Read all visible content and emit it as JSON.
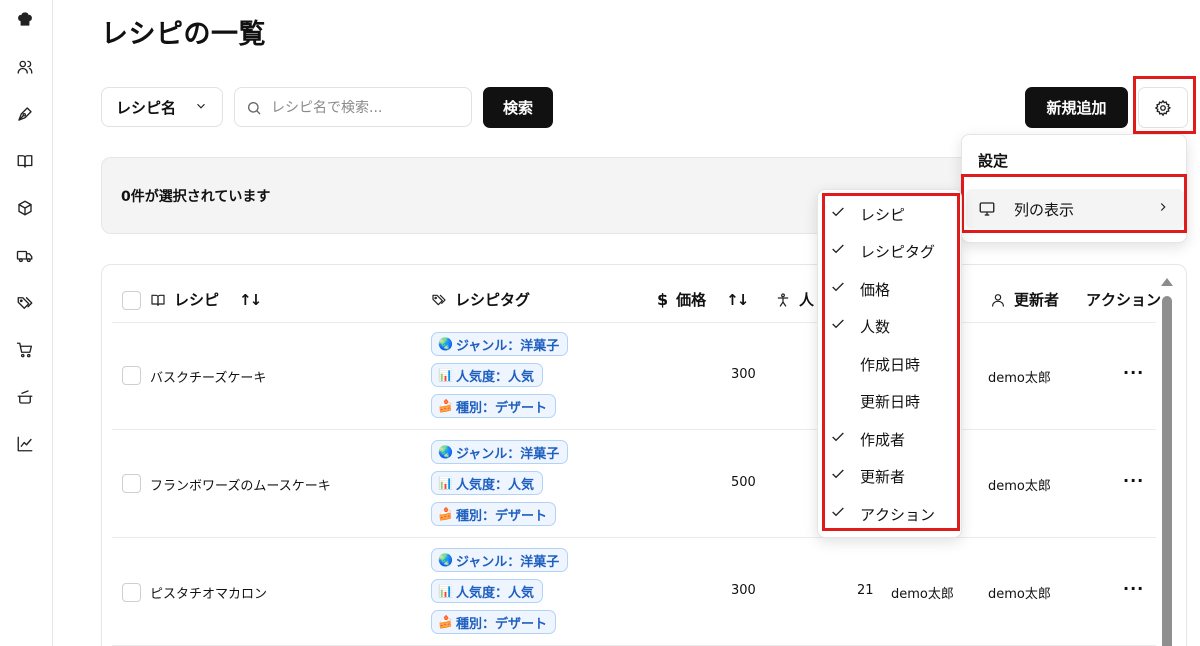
{
  "sidebar": {
    "icons": [
      "chef-hat-icon",
      "users-icon",
      "pen-icon",
      "book-icon",
      "box-icon",
      "truck-icon",
      "tags-icon",
      "cart-icon",
      "pot-icon",
      "chart-icon"
    ]
  },
  "page": {
    "title": "レシピの一覧"
  },
  "toolbar": {
    "filter_select": "レシピ名",
    "search_placeholder": "レシピ名で検索...",
    "search_button": "検索",
    "new_button": "新規追加"
  },
  "selection": {
    "text": "0件が選択されています"
  },
  "table": {
    "headers": {
      "recipe": "レシピ",
      "tags": "レシピタグ",
      "price": "価格",
      "people": "人",
      "updater": "更新者",
      "action": "アクション",
      "sort_glyph": "↑↓"
    },
    "rows": [
      {
        "name": "バスクチーズケーキ",
        "tags": [
          {
            "icon": "🌏",
            "label": "ジャンル：洋菓子"
          },
          {
            "icon": "📊",
            "label": "人気度：人気"
          },
          {
            "icon": "🍰",
            "label": "種別：デザート"
          }
        ],
        "price": "300",
        "people": "",
        "creator": "",
        "updater": "demo太郎",
        "action": "···"
      },
      {
        "name": "フランボワーズのムースケーキ",
        "tags": [
          {
            "icon": "🌏",
            "label": "ジャンル：洋菓子"
          },
          {
            "icon": "📊",
            "label": "人気度：人気"
          },
          {
            "icon": "🍰",
            "label": "種別：デザート"
          }
        ],
        "price": "500",
        "people": "",
        "creator": "",
        "updater": "demo太郎",
        "action": "···"
      },
      {
        "name": "ピスタチオマカロン",
        "tags": [
          {
            "icon": "🌏",
            "label": "ジャンル：洋菓子"
          },
          {
            "icon": "📊",
            "label": "人気度：人気"
          },
          {
            "icon": "🍰",
            "label": "種別：デザート"
          }
        ],
        "price": "300",
        "people": "21",
        "creator": "demo太郎",
        "updater": "demo太郎",
        "action": "···"
      }
    ]
  },
  "settings_menu": {
    "title": "設定",
    "item": "列の表示"
  },
  "column_menu": {
    "options": [
      {
        "label": "レシピ",
        "checked": true
      },
      {
        "label": "レシピタグ",
        "checked": true
      },
      {
        "label": "価格",
        "checked": true
      },
      {
        "label": "人数",
        "checked": true
      },
      {
        "label": "作成日時",
        "checked": false
      },
      {
        "label": "更新日時",
        "checked": false
      },
      {
        "label": "作成者",
        "checked": true
      },
      {
        "label": "更新者",
        "checked": true
      },
      {
        "label": "アクション",
        "checked": true
      }
    ]
  },
  "colors": {
    "highlight": "#e01b1b",
    "tag_bg": "#eef5ff",
    "tag_text": "#1f5fbf",
    "primary": "#111111"
  }
}
